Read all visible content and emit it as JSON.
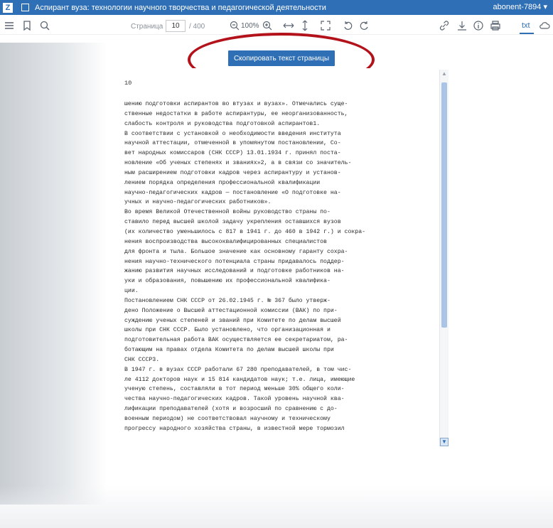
{
  "titlebar": {
    "logo": "Z",
    "title": "Аспирант вуза: технологии научного творчества и педагогической деятельности",
    "user": "abonent-7894 ▾"
  },
  "toolbar": {
    "page_label": "Страница",
    "page_value": "10",
    "page_total": "/ 400",
    "zoom": "100%",
    "txt_label": "txt",
    "icons": [
      "menu-icon",
      "bookmark-icon",
      "search-icon",
      "zoom-out-icon",
      "zoom-in-icon",
      "fit-width-icon",
      "fit-height-icon",
      "fullscreen-icon",
      "rotate-left-icon",
      "rotate-right-icon",
      "link-icon",
      "download-icon",
      "info-icon",
      "print-icon",
      "cloud-icon"
    ]
  },
  "copy_button": {
    "label": "Скопировать текст страницы"
  },
  "document": {
    "page_number": "10",
    "text": "шению подготовки аспирантов во втузах и вузах». Отмечались суще-\nственные недостатки в работе аспирантуры, ее неорганизованность,\nслабость контроля и руководства подготовкой аспирантов1.\nВ соответствии с установкой о необходимости введения института\nнаучной аттестации, отмеченной в упомянутом постановлении, Со-\nвет народных комиссаров (СНК СССР) 13.01.1934 г. принял поста-\nновление «Об ученых степенях и званиях»2, а в связи со значитель-\nным расширением подготовки кадров через аспирантуру и установ-\nлением порядка определения профессиональной квалификации\nнаучно-педагогических кадров — постановление «О подготовке на-\nучных и научно-педагогических работников».\nВо время Великой Отечественной войны руководство страны по-\nставило перед высшей школой задачу укрепления оставшихся вузов\n(их количество уменьшилось с 817 в 1941 г. до 460 в 1942 г.) и сокра-\nнения воспроизводства высококвалифицированных специалистов\nдля фронта и тыла. Большое значение как основному гаранту сохра-\nнения научно-технического потенциала страны придавалось поддер-\nжанию развития научных исследований и подготовке работников на-\nуки и образования, повышению их профессиональной квалифика-\nции.\nПостановлением СНК СССР от 26.02.1945 г. № 367 было утверж-\nдено Положение о Высшей аттестационной комиссии (ВАК) по при-\nсуждению ученых степеней и званий при Комитете по делам высшей\nшколы при СНК СССР. Было установлено, что организационная и\nподготовительная работа ВАК осуществляется ее секретариатом, ра-\nботающим на правах отдела Комитета по делам высшей школы при\nСНК СССР3.\nВ 1947 г. в вузах СССР работали 67 280 преподавателей, в том чис-\nле 4112 докторов наук и 15 814 кандидатов наук; т.е. лица, имеющие\nученую степень, составляли в тот период меньше 30% общего коли-\nчества научно-педагогических кадров. Такой уровень научной ква-\nлификации преподавателей (хотя и возросший по сравнению с до-\nвоенным периодом) не соответствовал научному и техническому\nпрогрессу народного хозяйства страны, в известной мере тормозил"
  },
  "colors": {
    "accent": "#2f6fb6",
    "highlight": "#b3121b"
  }
}
